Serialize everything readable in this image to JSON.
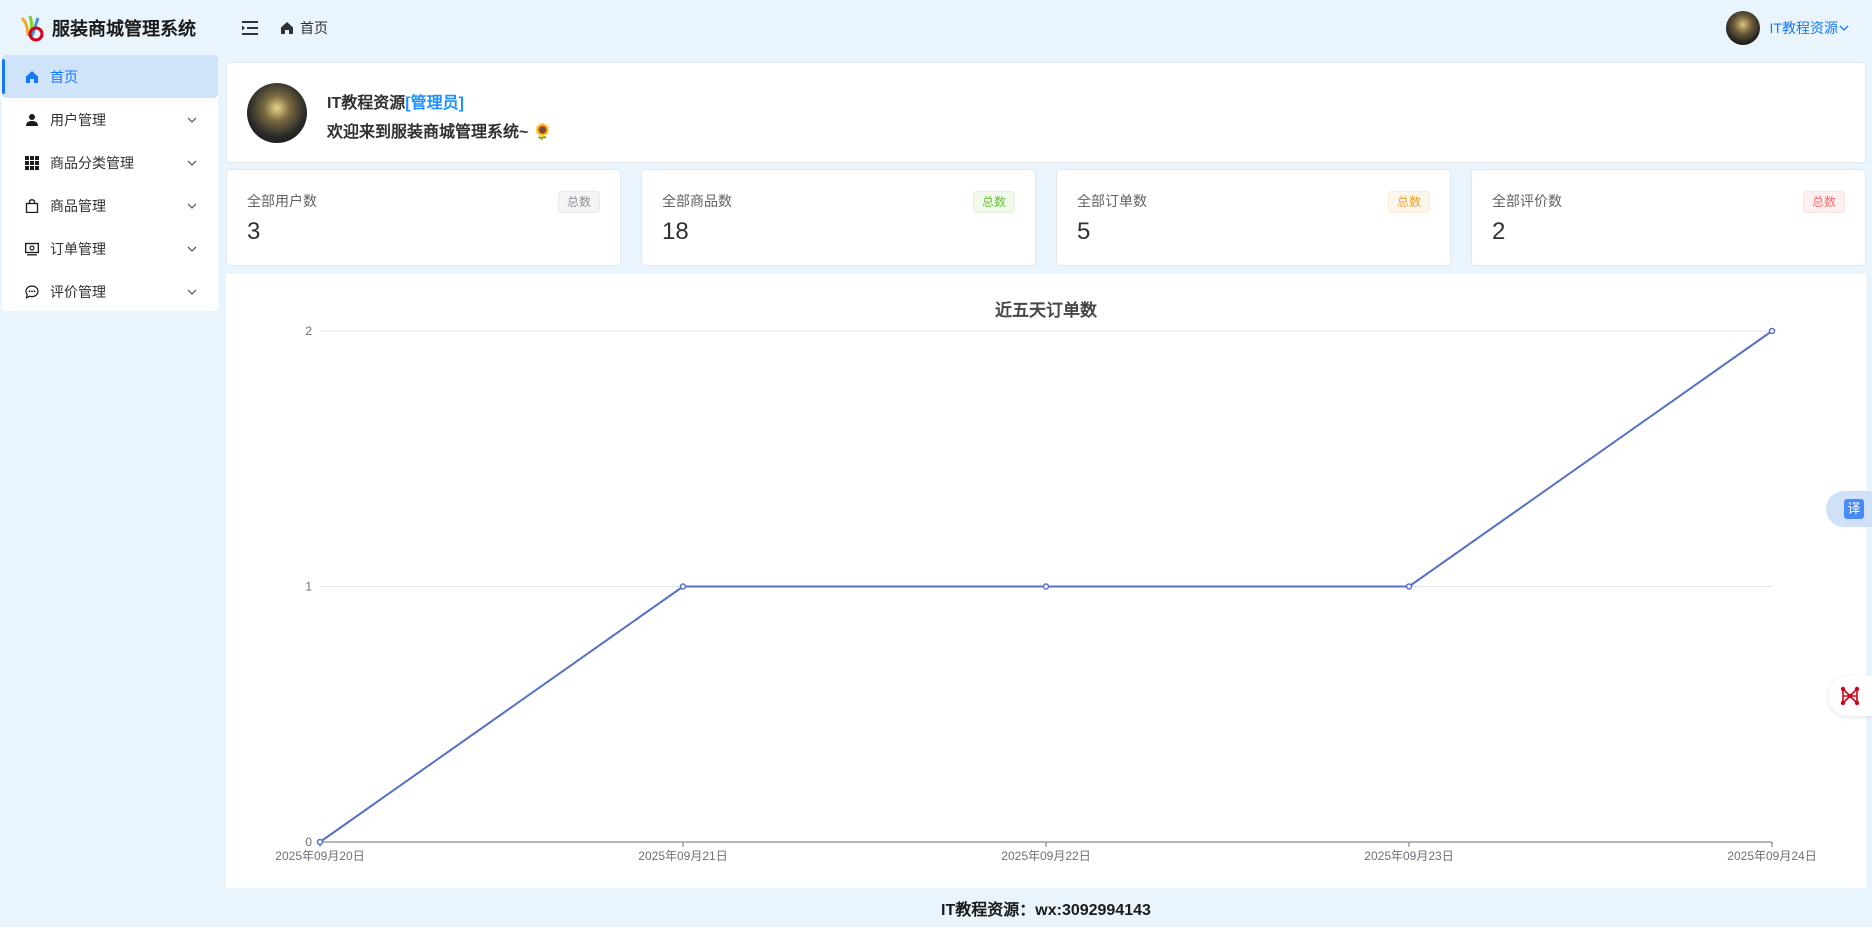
{
  "app": {
    "title": "服装商城管理系统"
  },
  "sidebar": {
    "items": [
      {
        "label": "首页",
        "icon": "home-icon",
        "active": true
      },
      {
        "label": "用户管理",
        "icon": "user-icon"
      },
      {
        "label": "商品分类管理",
        "icon": "grid-icon"
      },
      {
        "label": "商品管理",
        "icon": "bag-icon"
      },
      {
        "label": "订单管理",
        "icon": "order-icon"
      },
      {
        "label": "评价管理",
        "icon": "comment-icon"
      }
    ]
  },
  "header": {
    "breadcrumb": "首页",
    "user_name": "IT教程资源"
  },
  "welcome": {
    "name": "IT教程资源",
    "role": "[管理员]",
    "message": "欢迎来到服装商城管理系统~ 🌻"
  },
  "stats": [
    {
      "label": "全部用户数",
      "value": "3",
      "tag": "总数",
      "tag_color": "#909399"
    },
    {
      "label": "全部商品数",
      "value": "18",
      "tag": "总数",
      "tag_color": "#67c23a"
    },
    {
      "label": "全部订单数",
      "value": "5",
      "tag": "总数",
      "tag_color": "#e6a23c"
    },
    {
      "label": "全部评价数",
      "value": "2",
      "tag": "总数",
      "tag_color": "#f56c6c"
    }
  ],
  "chart_data": {
    "type": "line",
    "title": "近五天订单数",
    "categories": [
      "2025年09月20日",
      "2025年09月21日",
      "2025年09月22日",
      "2025年09月23日",
      "2025年09月24日"
    ],
    "values": [
      0,
      1,
      1,
      1,
      2
    ],
    "ylim": [
      0,
      2
    ],
    "yticks": [
      "0",
      "1",
      "2"
    ],
    "line_color": "#5470c6",
    "grid": true,
    "legend": "none"
  },
  "footer": {
    "text": "IT教程资源：wx:3092994143"
  },
  "floating": {
    "translate_label": "译"
  }
}
